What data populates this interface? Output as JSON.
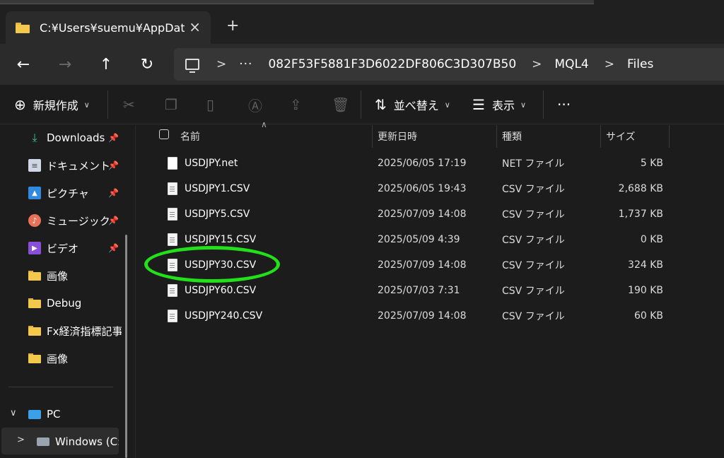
{
  "tab": {
    "title": "C:¥Users¥suemu¥AppData¥",
    "close_icon": "×",
    "new_tab_icon": "+"
  },
  "nav": {
    "back": "←",
    "forward": "→",
    "up": "↑",
    "refresh": "↻"
  },
  "address": {
    "separator": ">",
    "overflow": "···",
    "crumbs": [
      "082F53F5881F3D6022DF806C3D307B50",
      "MQL4",
      "Files"
    ]
  },
  "toolbar": {
    "new_label": "新規作成",
    "sort_label": "並べ替え",
    "view_label": "表示",
    "more_label": "···"
  },
  "sidebar": {
    "items": [
      {
        "label": "Downloads"
      },
      {
        "label": "ドキュメント"
      },
      {
        "label": "ピクチャ"
      },
      {
        "label": "ミュージック"
      },
      {
        "label": "ビデオ"
      },
      {
        "label": "画像"
      },
      {
        "label": "Debug"
      },
      {
        "label": "Fx経済指標記事"
      },
      {
        "label": "画像"
      }
    ],
    "pc_label": "PC",
    "drive_label": "Windows (C:)"
  },
  "columns": {
    "name": "名前",
    "date": "更新日時",
    "type": "種類",
    "size": "サイズ"
  },
  "files": [
    {
      "name": "USDJPY.net",
      "date": "2025/06/05 17:19",
      "type": "NET ファイル",
      "size": "5 KB"
    },
    {
      "name": "USDJPY1.CSV",
      "date": "2025/06/05 19:43",
      "type": "CSV ファイル",
      "size": "2,688 KB"
    },
    {
      "name": "USDJPY5.CSV",
      "date": "2025/07/09 14:08",
      "type": "CSV ファイル",
      "size": "1,737 KB"
    },
    {
      "name": "USDJPY15.CSV",
      "date": "2025/05/09 4:39",
      "type": "CSV ファイル",
      "size": "0 KB"
    },
    {
      "name": "USDJPY30.CSV",
      "date": "2025/07/09 14:08",
      "type": "CSV ファイル",
      "size": "324 KB"
    },
    {
      "name": "USDJPY60.CSV",
      "date": "2025/07/03 7:31",
      "type": "CSV ファイル",
      "size": "190 KB"
    },
    {
      "name": "USDJPY240.CSV",
      "date": "2025/07/09 14:08",
      "type": "CSV ファイル",
      "size": "60 KB"
    }
  ],
  "colors": {
    "highlight": "#22e01a",
    "folder": "#f2c94c"
  }
}
